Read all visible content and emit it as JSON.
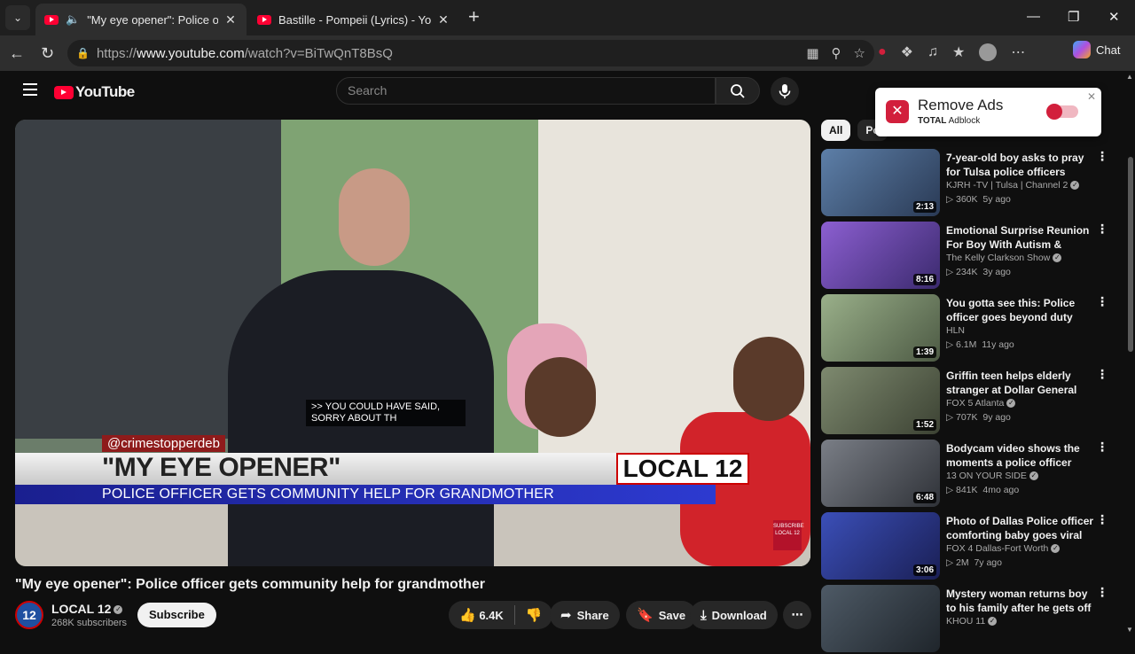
{
  "browser": {
    "tabs": [
      {
        "title": "\"My eye opener\": Police officer gets community help for grandmother",
        "active": true
      },
      {
        "title": "Bastille - Pompeii (Lyrics) - YouTube",
        "active": false
      }
    ],
    "url_prefix": "https://",
    "url_host": "www.youtube.com",
    "url_path": "/watch?v=BiTwQnT8BsQ",
    "chat_label": "Chat"
  },
  "youtube": {
    "logo_text": "YouTube",
    "search_placeholder": "Search"
  },
  "video": {
    "caption": ">> YOU COULD HAVE SAID, SORRY ABOUT TH",
    "handle": "@crimestopperdeb",
    "lower_title": "\"MY EYE OPENER\"",
    "lower_subtitle": "POLICE OFFICER GETS COMMUNITY HELP FOR GRANDMOTHER",
    "station_logo": "LOCAL 12",
    "subscribe_badge": "SUBSCRIBE LOCAL 12",
    "title": "\"My eye opener\": Police officer gets community help for grandmother"
  },
  "channel": {
    "avatar_text": "12",
    "name": "LOCAL 12",
    "subscribers": "268K subscribers",
    "subscribe_label": "Subscribe"
  },
  "actions": {
    "likes": "6.4K",
    "share": "Share",
    "save": "Save",
    "download": "Download"
  },
  "chips": [
    "All",
    "Po"
  ],
  "related": [
    {
      "title": "7-year-old boy asks to pray for Tulsa police officers",
      "channel": "KJRH -TV | Tulsa | Channel 2",
      "verified": true,
      "views": "360K",
      "age": "5y ago",
      "duration": "2:13",
      "colors": [
        "#5d7fa8",
        "#2a3a55"
      ]
    },
    {
      "title": "Emotional Surprise Reunion For Boy With Autism & Police ...",
      "channel": "The Kelly Clarkson Show",
      "verified": true,
      "views": "234K",
      "age": "3y ago",
      "duration": "8:16",
      "colors": [
        "#8c5fd1",
        "#3b2a6e"
      ]
    },
    {
      "title": "You gotta see this: Police officer goes beyond duty",
      "channel": "HLN",
      "verified": false,
      "views": "6.1M",
      "age": "11y ago",
      "duration": "1:39",
      "colors": [
        "#9ab08a",
        "#4d5a44"
      ]
    },
    {
      "title": "Griffin teen helps elderly stranger at Dollar General",
      "channel": "FOX 5 Atlanta",
      "verified": true,
      "views": "707K",
      "age": "9y ago",
      "duration": "1:52",
      "colors": [
        "#7e8a6f",
        "#3c4233"
      ]
    },
    {
      "title": "Bodycam video shows the moments a police officer save...",
      "channel": "13 ON YOUR SIDE",
      "verified": true,
      "views": "841K",
      "age": "4mo ago",
      "duration": "6:48",
      "colors": [
        "#7a7e86",
        "#2f3238"
      ]
    },
    {
      "title": "Photo of Dallas Police officer comforting baby goes viral",
      "channel": "FOX 4 Dallas-Fort Worth",
      "verified": true,
      "views": "2M",
      "age": "7y ago",
      "duration": "3:06",
      "colors": [
        "#3b4fb8",
        "#1a1f55"
      ]
    },
    {
      "title": "Mystery woman returns boy to his family after he gets off at ...",
      "channel": "KHOU 11",
      "verified": true,
      "views": "",
      "age": "",
      "duration": "",
      "colors": [
        "#4e5a66",
        "#1f252b"
      ]
    }
  ],
  "adblock": {
    "title": "Remove Ads",
    "brand_bold": "TOTAL",
    "brand_rest": "Adblock"
  }
}
